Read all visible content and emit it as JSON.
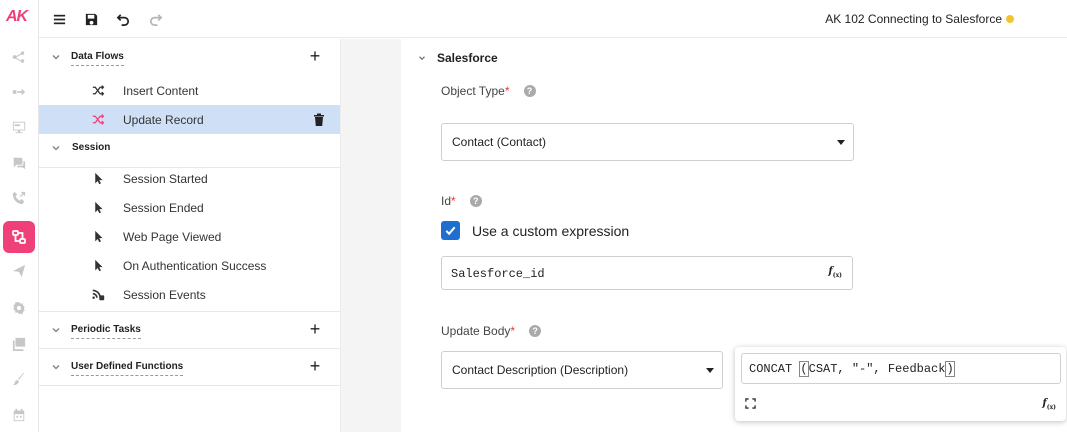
{
  "app": {
    "logo_text": "AK",
    "title": "AK 102 Connecting to Salesforce",
    "status_color": "#f4c430",
    "accent_color": "#f0407a",
    "selection_color": "#cfe0f6"
  },
  "rail": {
    "items": [
      {
        "name": "connections-icon",
        "active": false
      },
      {
        "name": "flow-icon",
        "active": false
      },
      {
        "name": "screen-icon",
        "active": false
      },
      {
        "name": "chat-icon",
        "active": false
      },
      {
        "name": "phone-icon",
        "active": false
      },
      {
        "name": "data-flows-icon",
        "active": true
      },
      {
        "name": "send-icon",
        "active": false
      },
      {
        "name": "settings-icon",
        "active": false
      },
      {
        "name": "gallery-icon",
        "active": false
      },
      {
        "name": "brush-icon",
        "active": false
      },
      {
        "name": "calendar-icon",
        "active": false
      }
    ]
  },
  "toolbar": {
    "menu_icon": "menu-icon",
    "save_icon": "save-icon",
    "undo_icon": "undo-icon",
    "redo_icon": "redo-icon"
  },
  "tree": {
    "data_flows": {
      "label": "Data Flows",
      "items": [
        {
          "label": "Insert Content",
          "icon": "shuffle-icon"
        },
        {
          "label": "Update Record",
          "icon": "shuffle-icon",
          "selected": true
        }
      ]
    },
    "session": {
      "label": "Session",
      "items": [
        {
          "label": "Session Started",
          "icon": "cursor-icon"
        },
        {
          "label": "Session Ended",
          "icon": "cursor-icon"
        },
        {
          "label": "Web Page Viewed",
          "icon": "cursor-icon"
        },
        {
          "label": "On Authentication Success",
          "icon": "cursor-icon"
        },
        {
          "label": "Session Events",
          "icon": "events-icon"
        }
      ]
    },
    "periodic_tasks": {
      "label": "Periodic Tasks"
    },
    "user_defined_functions": {
      "label": "User Defined Functions"
    }
  },
  "main": {
    "section_title": "Salesforce",
    "object_type": {
      "label": "Object Type",
      "required_mark": "*",
      "help": "?",
      "value": "Contact (Contact)"
    },
    "id_field": {
      "label": "Id",
      "required_mark": "*",
      "help": "?",
      "checkbox_label": "Use a custom expression",
      "checked": true,
      "expression": "Salesforce_id",
      "fx_label": "f",
      "fx_sub": "(x)"
    },
    "update_body": {
      "label": "Update Body",
      "required_mark": "*",
      "help": "?",
      "value": "Contact Description (Description)"
    }
  },
  "popup": {
    "code_prefix": "CONCAT ",
    "open_paren": "(",
    "code_middle": "CSAT, \"-\", Feedback",
    "close_paren": ")",
    "fx_label": "f",
    "fx_sub": "(x)"
  }
}
